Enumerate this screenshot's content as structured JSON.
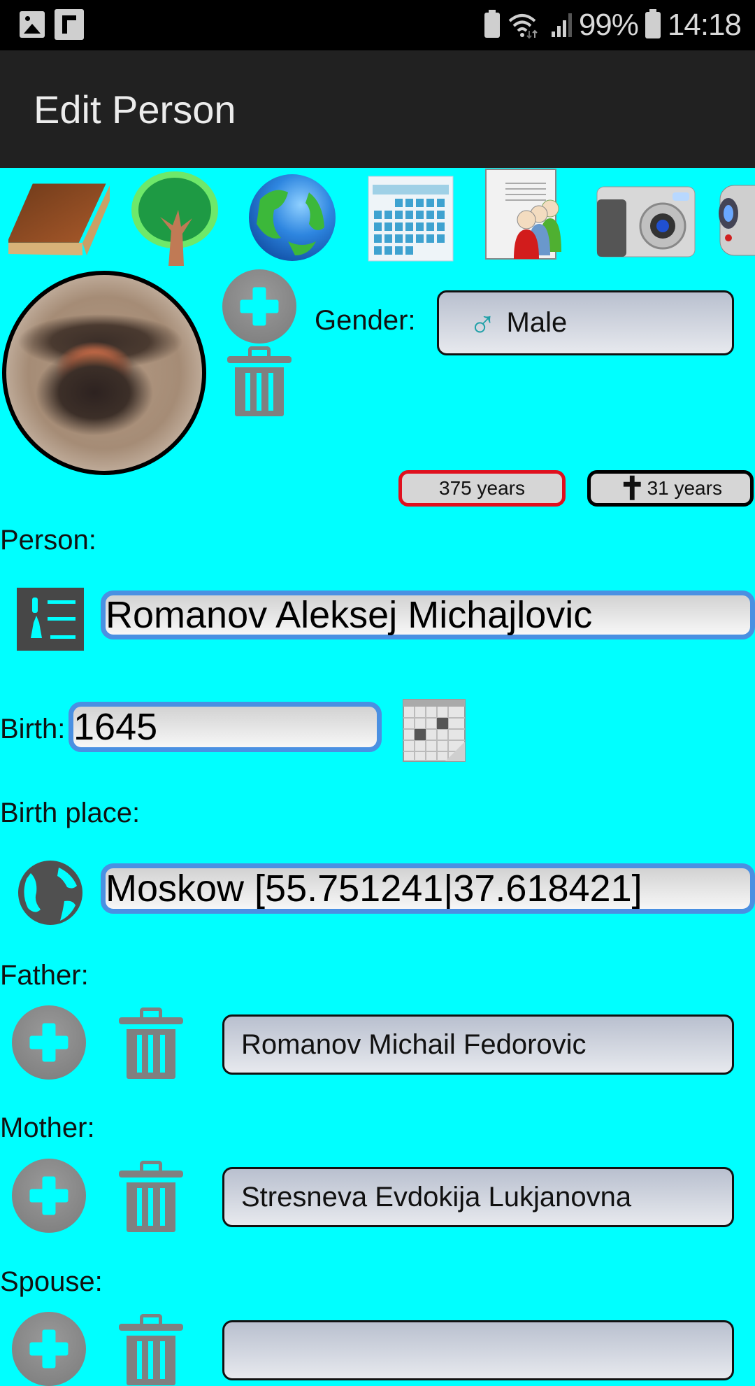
{
  "status_bar": {
    "left_icons": [
      "gallery-icon",
      "flipboard-icon"
    ],
    "right_icons": [
      "battery-saver-icon",
      "wifi-icon",
      "signal-icon"
    ],
    "battery": "99%",
    "battery_icon": "battery-charging-icon",
    "time": "14:18"
  },
  "app_bar": {
    "title": "Edit Person"
  },
  "toolbar": {
    "items": [
      {
        "name": "book",
        "icon": "book-icon"
      },
      {
        "name": "tree",
        "icon": "tree-icon"
      },
      {
        "name": "globe",
        "icon": "globe-icon"
      },
      {
        "name": "calendar",
        "icon": "calendar-icon"
      },
      {
        "name": "persons-document",
        "icon": "people-document-icon"
      },
      {
        "name": "camera",
        "icon": "camera-icon"
      },
      {
        "name": "video-camera",
        "icon": "video-camera-icon"
      }
    ]
  },
  "photo": {
    "add_icon": "add-circle-icon",
    "delete_icon": "trash-icon"
  },
  "gender": {
    "label": "Gender:",
    "value": "Male",
    "symbol": "♂",
    "icon": "male-symbol-icon"
  },
  "ages": {
    "age": "375 years",
    "age_border_color": "#e0101e",
    "died_age": "31 years",
    "died_symbol": "✝",
    "died_border_color": "#000000"
  },
  "person": {
    "label": "Person:",
    "value": "Romanov Aleksej Michajlovic",
    "icon": "person-list-icon"
  },
  "birth": {
    "label": "Birth:",
    "value": "1645",
    "icon": "calendar-picker-icon"
  },
  "birth_place": {
    "label": "Birth place:",
    "value": "Moskow [55.751241|37.618421]",
    "icon": "globe-pin-icon"
  },
  "father": {
    "label": "Father:",
    "value": "Romanov Michail Fedorovic"
  },
  "mother": {
    "label": "Mother:",
    "value": "Stresneva Evdokija Lukjanovna"
  },
  "spouse": {
    "label": "Spouse:",
    "value": ""
  },
  "colors": {
    "background": "#00ffff",
    "app_bar": "#212121",
    "status_bar": "#000000",
    "input_border": "#4a90e2",
    "icon_gray": "#808080"
  }
}
